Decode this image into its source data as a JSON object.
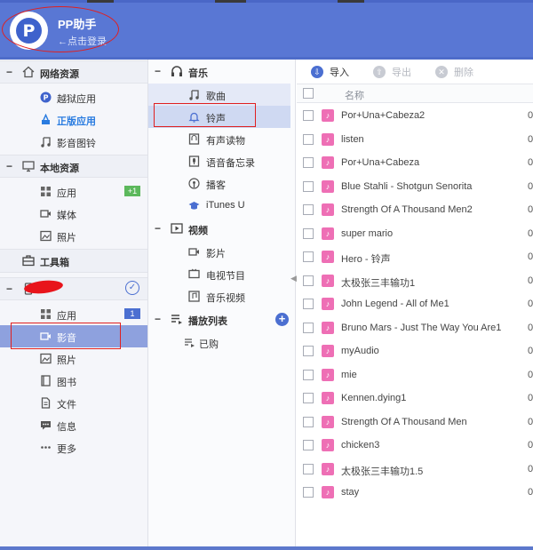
{
  "header": {
    "logo_letter": "P",
    "app_name": "PP助手",
    "login_text": "←点击登录"
  },
  "sidebar": {
    "sections": [
      {
        "title": "网络资源",
        "icon": "home-icon",
        "items": [
          {
            "label": "越狱应用",
            "icon": "pp-app-icon"
          },
          {
            "label": "正版应用",
            "icon": "app-store-icon"
          },
          {
            "label": "影音图铃",
            "icon": "music-note-icon"
          }
        ]
      },
      {
        "title": "本地资源",
        "icon": "monitor-icon",
        "items": [
          {
            "label": "应用",
            "icon": "grid-icon",
            "badge": "+1"
          },
          {
            "label": "媒体",
            "icon": "video-icon"
          },
          {
            "label": "照片",
            "icon": "photo-icon"
          }
        ]
      },
      {
        "title": "工具箱",
        "icon": "toolbox-icon"
      },
      {
        "icon": "phone-icon",
        "items": [
          {
            "label": "应用",
            "icon": "grid-icon",
            "badge": "1"
          },
          {
            "label": "影音",
            "icon": "video-icon"
          },
          {
            "label": "照片",
            "icon": "photo-icon"
          },
          {
            "label": "图书",
            "icon": "book-icon"
          },
          {
            "label": "文件",
            "icon": "file-icon"
          },
          {
            "label": "信息",
            "icon": "message-icon"
          },
          {
            "label": "更多",
            "icon": "more-icon"
          }
        ]
      }
    ]
  },
  "media_nav": {
    "music": {
      "title": "音乐",
      "items": [
        {
          "label": "歌曲",
          "icon": "music-note-icon"
        },
        {
          "label": "铃声",
          "icon": "bell-icon"
        },
        {
          "label": "有声读物",
          "icon": "audiobook-icon"
        },
        {
          "label": "语音备忘录",
          "icon": "microphone-icon"
        },
        {
          "label": "播客",
          "icon": "podcast-icon"
        },
        {
          "label": "iTunes U",
          "icon": "graduation-cap-icon"
        }
      ]
    },
    "video": {
      "title": "视频",
      "items": [
        {
          "label": "影片",
          "icon": "movie-icon"
        },
        {
          "label": "电视节目",
          "icon": "tv-icon"
        },
        {
          "label": "音乐视频",
          "icon": "music-video-icon"
        }
      ]
    },
    "playlist": {
      "title": "播放列表",
      "items": [
        {
          "label": "已购",
          "icon": "playlist-icon"
        }
      ]
    }
  },
  "toolbar": {
    "import_label": "导入",
    "export_label": "导出",
    "delete_label": "删除"
  },
  "table": {
    "name_header": "名称",
    "rows": [
      {
        "name": "Por+Una+Cabeza2",
        "col2": "0"
      },
      {
        "name": "listen",
        "col2": "0"
      },
      {
        "name": "Por+Una+Cabeza",
        "col2": "0"
      },
      {
        "name": "Blue Stahli - Shotgun Senorita",
        "col2": "0"
      },
      {
        "name": "Strength Of A Thousand Men2",
        "col2": "0"
      },
      {
        "name": "super mario",
        "col2": "0"
      },
      {
        "name": "Hero - 铃声",
        "col2": "0"
      },
      {
        "name": "太极张三丰输功1",
        "col2": "0"
      },
      {
        "name": "John Legend - All of Me1",
        "col2": "0"
      },
      {
        "name": "Bruno Mars - Just The Way You Are1",
        "col2": "0"
      },
      {
        "name": "myAudio",
        "col2": "0"
      },
      {
        "name": "mie",
        "col2": "0"
      },
      {
        "name": "Kennen.dying1",
        "col2": "0"
      },
      {
        "name": "Strength Of A Thousand Men",
        "col2": "0"
      },
      {
        "name": "chicken3",
        "col2": "0"
      },
      {
        "name": "太极张三丰输功1.5",
        "col2": "0"
      },
      {
        "name": "stay",
        "col2": "0"
      }
    ]
  },
  "colors": {
    "header_bg": "#5977d4",
    "accent": "#4b6fd1",
    "selected_sidebar": "#8ea1de",
    "ringtone_pink": "#ee6fb5",
    "annotation_red": "#e02020"
  }
}
